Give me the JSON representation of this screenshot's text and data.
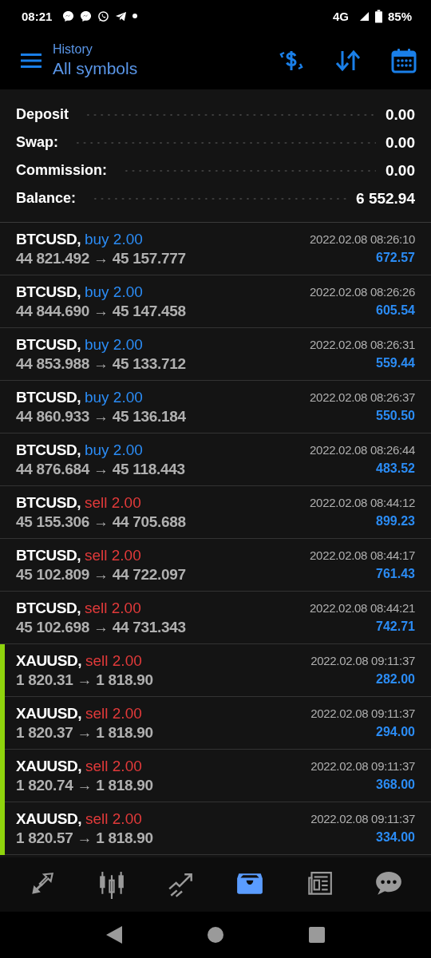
{
  "status_bar": {
    "time": "08:21",
    "network": "4G",
    "battery": "85%"
  },
  "header": {
    "subtitle": "History",
    "title": "All symbols"
  },
  "summary": [
    {
      "label": "Deposit",
      "value": "0.00"
    },
    {
      "label": "Swap:",
      "value": "0.00"
    },
    {
      "label": "Commission:",
      "value": "0.00"
    },
    {
      "label": "Balance:",
      "value": "6 552.94"
    }
  ],
  "trades": [
    {
      "symbol": "BTCUSD,",
      "kind": "buy",
      "deal": "buy 2.00",
      "prices": "44 821.492 → 45 157.777",
      "time": "2022.02.08 08:26:10",
      "profit": "672.57",
      "marked": false
    },
    {
      "symbol": "BTCUSD,",
      "kind": "buy",
      "deal": "buy 2.00",
      "prices": "44 844.690 → 45 147.458",
      "time": "2022.02.08 08:26:26",
      "profit": "605.54",
      "marked": false
    },
    {
      "symbol": "BTCUSD,",
      "kind": "buy",
      "deal": "buy 2.00",
      "prices": "44 853.988 → 45 133.712",
      "time": "2022.02.08 08:26:31",
      "profit": "559.44",
      "marked": false
    },
    {
      "symbol": "BTCUSD,",
      "kind": "buy",
      "deal": "buy 2.00",
      "prices": "44 860.933 → 45 136.184",
      "time": "2022.02.08 08:26:37",
      "profit": "550.50",
      "marked": false
    },
    {
      "symbol": "BTCUSD,",
      "kind": "buy",
      "deal": "buy 2.00",
      "prices": "44 876.684 → 45 118.443",
      "time": "2022.02.08 08:26:44",
      "profit": "483.52",
      "marked": false
    },
    {
      "symbol": "BTCUSD,",
      "kind": "sell",
      "deal": "sell 2.00",
      "prices": "45 155.306 → 44 705.688",
      "time": "2022.02.08 08:44:12",
      "profit": "899.23",
      "marked": false
    },
    {
      "symbol": "BTCUSD,",
      "kind": "sell",
      "deal": "sell 2.00",
      "prices": "45 102.809 → 44 722.097",
      "time": "2022.02.08 08:44:17",
      "profit": "761.43",
      "marked": false
    },
    {
      "symbol": "BTCUSD,",
      "kind": "sell",
      "deal": "sell 2.00",
      "prices": "45 102.698 → 44 731.343",
      "time": "2022.02.08 08:44:21",
      "profit": "742.71",
      "marked": false
    },
    {
      "symbol": "XAUUSD,",
      "kind": "sell",
      "deal": "sell 2.00",
      "prices": "1 820.31 → 1 818.90",
      "time": "2022.02.08 09:11:37",
      "profit": "282.00",
      "marked": true
    },
    {
      "symbol": "XAUUSD,",
      "kind": "sell",
      "deal": "sell 2.00",
      "prices": "1 820.37 → 1 818.90",
      "time": "2022.02.08 09:11:37",
      "profit": "294.00",
      "marked": true
    },
    {
      "symbol": "XAUUSD,",
      "kind": "sell",
      "deal": "sell 2.00",
      "prices": "1 820.74 → 1 818.90",
      "time": "2022.02.08 09:11:37",
      "profit": "368.00",
      "marked": true
    },
    {
      "symbol": "XAUUSD,",
      "kind": "sell",
      "deal": "sell 2.00",
      "prices": "1 820.57 → 1 818.90",
      "time": "2022.02.08 09:11:37",
      "profit": "334.00",
      "marked": true
    }
  ],
  "bottom_nav": [
    {
      "kind": "trade",
      "selected": false
    },
    {
      "kind": "quotes",
      "selected": false
    },
    {
      "kind": "chart",
      "selected": false
    },
    {
      "kind": "history",
      "selected": true
    },
    {
      "kind": "news",
      "selected": false
    },
    {
      "kind": "chat",
      "selected": false
    }
  ]
}
